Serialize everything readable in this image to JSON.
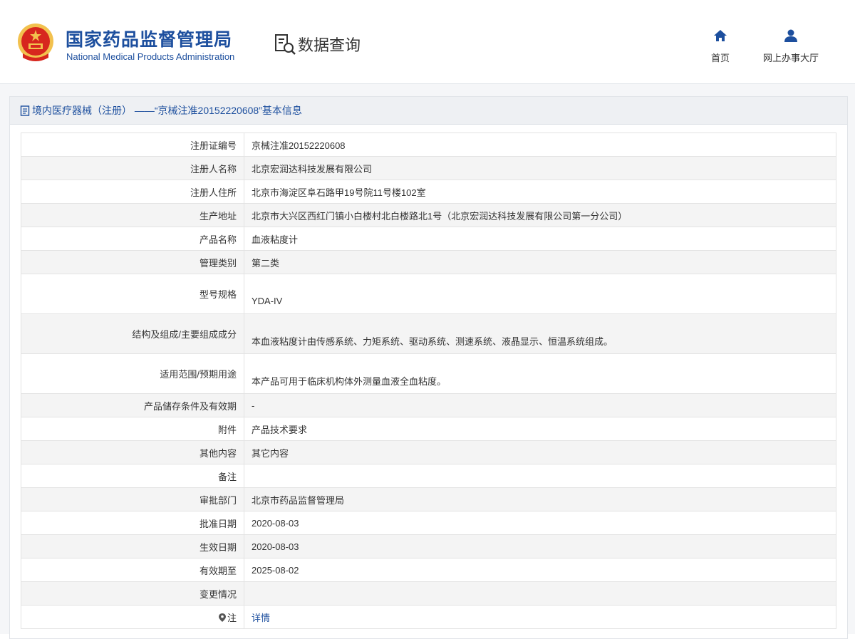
{
  "header": {
    "org_name_cn": "国家药品监督管理局",
    "org_name_en": "National Medical Products Administration",
    "query_title": "数据查询",
    "nav": {
      "home": "首页",
      "online_hall": "网上办事大厅"
    }
  },
  "panel": {
    "title": "境内医疗器械（注册） ——“京械注准20152220608”基本信息"
  },
  "rows": [
    {
      "label": "注册证编号",
      "value": "京械注准20152220608"
    },
    {
      "label": "注册人名称",
      "value": "北京宏润达科技发展有限公司"
    },
    {
      "label": "注册人住所",
      "value": "北京市海淀区阜石路甲19号院11号楼102室"
    },
    {
      "label": "生产地址",
      "value": "北京市大兴区西红门镇小白楼村北白楼路北1号（北京宏润达科技发展有限公司第一分公司）"
    },
    {
      "label": "产品名称",
      "value": "血液粘度计"
    },
    {
      "label": "管理类别",
      "value": "第二类"
    },
    {
      "label": "型号规格",
      "value": "YDA-IV"
    },
    {
      "label": "结构及组成/主要组成成分",
      "value": "本血液粘度计由传感系统、力矩系统、驱动系统、测速系统、液晶显示、恒温系统组成。"
    },
    {
      "label": "适用范围/预期用途",
      "value": "本产品可用于临床机构体外测量血液全血粘度。"
    },
    {
      "label": "产品储存条件及有效期",
      "value": "-"
    },
    {
      "label": "附件",
      "value": "产品技术要求"
    },
    {
      "label": "其他内容",
      "value": "其它内容"
    },
    {
      "label": "备注",
      "value": ""
    },
    {
      "label": "审批部门",
      "value": "北京市药品监督管理局"
    },
    {
      "label": "批准日期",
      "value": "2020-08-03"
    },
    {
      "label": "生效日期",
      "value": "2020-08-03"
    },
    {
      "label": "有效期至",
      "value": "2025-08-02"
    },
    {
      "label": "变更情况",
      "value": ""
    },
    {
      "label": "注",
      "value": "详情"
    }
  ],
  "colors": {
    "brand_blue": "#1d4f9e",
    "emblem_red": "#d7261e",
    "emblem_gold": "#f2c14e"
  }
}
